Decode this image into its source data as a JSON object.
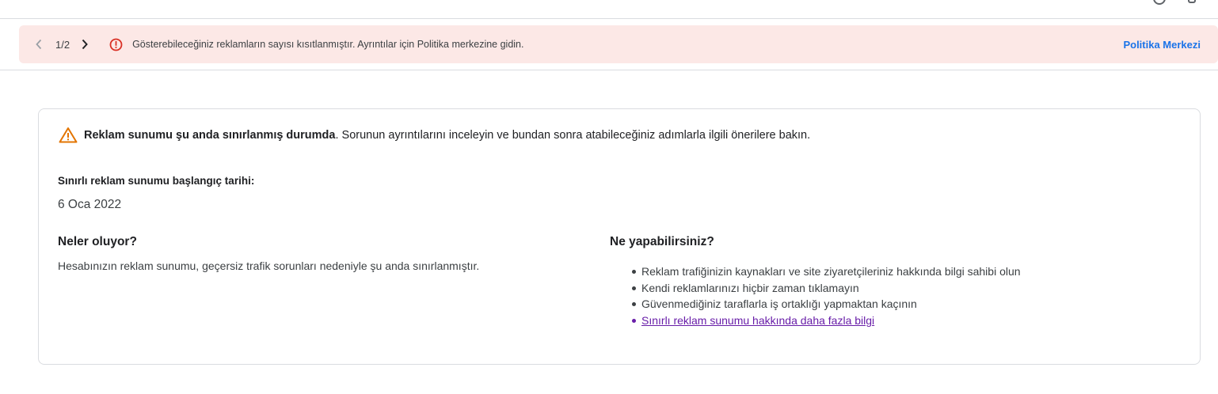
{
  "banner": {
    "pager": "1/2",
    "message": "Gösterebileceğiniz reklamların sayısı kısıtlanmıştır. Ayrıntılar için Politika merkezine gidin.",
    "link_label": "Politika Merkezi"
  },
  "card": {
    "warning_bold": "Reklam sunumu şu anda sınırlanmış durumda",
    "warning_rest": ". Sorunun ayrıntılarını inceleyin ve bundan sonra atabileceğiniz adımlarla ilgili önerilere bakın.",
    "date_label": "Sınırlı reklam sunumu başlangıç tarihi:",
    "date_value": "6 Oca 2022",
    "left_heading": "Neler oluyor?",
    "left_text": "Hesabınızın reklam sunumu, geçersiz trafik sorunları nedeniyle şu anda sınırlanmıştır.",
    "right_heading": "Ne yapabilirsiniz?",
    "tips": [
      "Reklam trafiğinizin kaynakları ve site ziyaretçileriniz hakkında bilgi sahibi olun",
      "Kendi reklamlarınızı hiçbir zaman tıklamayın",
      "Güvenmediğiniz taraflarla iş ortaklığı yapmaktan kaçının"
    ],
    "learn_more_link": "Sınırlı reklam sunumu hakkında daha fazla bilgi"
  },
  "colors": {
    "banner_bg": "#fce8e6",
    "error_red": "#d93025",
    "warning_orange": "#e37400",
    "link_blue": "#1a73e8",
    "visited_purple": "#681da8"
  },
  "icons": [
    "chevron-left-icon",
    "chevron-right-icon",
    "error-circle-icon",
    "warning-triangle-icon",
    "help-icon",
    "more-icon"
  ]
}
